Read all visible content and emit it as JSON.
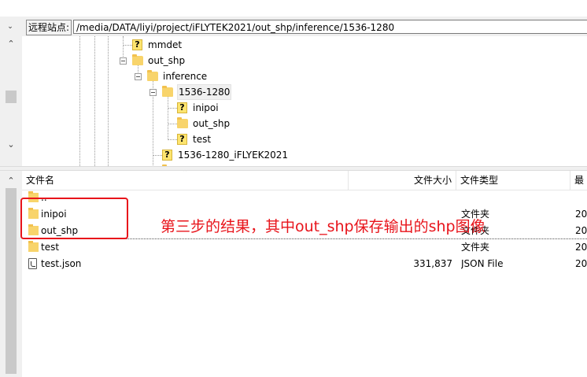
{
  "address_bar": {
    "label": "远程站点:",
    "path": "/media/DATA/liyi/project/iFLYTEK2021/out_shp/inference/1536-1280"
  },
  "tree": {
    "nodes": [
      {
        "label": "mmdet",
        "icon": "unknown-folder-icon"
      },
      {
        "label": "out_shp",
        "icon": "folder-icon",
        "expanded": true
      },
      {
        "label": "inference",
        "icon": "folder-icon",
        "expanded": true
      },
      {
        "label": "1536-1280",
        "icon": "folder-icon",
        "expanded": true,
        "selected": true
      },
      {
        "label": "inipoi",
        "icon": "unknown-folder-icon"
      },
      {
        "label": "out_shp",
        "icon": "folder-icon"
      },
      {
        "label": "test",
        "icon": "unknown-folder-icon"
      },
      {
        "label": "1536-1280_iFLYEK2021",
        "icon": "unknown-folder-icon"
      }
    ]
  },
  "file_list": {
    "columns": {
      "name": "文件名",
      "size": "文件大小",
      "type": "文件类型",
      "modified": "最"
    },
    "rows": [
      {
        "name": "..",
        "size": "",
        "type": "",
        "modified": "",
        "icon": "folder-icon"
      },
      {
        "name": "inipoi",
        "size": "",
        "type": "文件夹",
        "modified": "20",
        "icon": "folder-icon"
      },
      {
        "name": "out_shp",
        "size": "",
        "type": "文件夹",
        "modified": "20",
        "icon": "folder-icon"
      },
      {
        "name": "test",
        "size": "",
        "type": "文件夹",
        "modified": "20",
        "icon": "folder-icon"
      },
      {
        "name": "test.json",
        "size": "331,837",
        "type": "JSON File",
        "modified": "20",
        "icon": "json-file-icon"
      }
    ]
  },
  "annotation": {
    "text": "第三步的结果，其中out_shp保存输出的shp图像",
    "color": "#e8141b"
  },
  "colors": {
    "folder": "#f8d46b",
    "annotation_red": "#e8141b",
    "chrome_gray": "#f0f0f0"
  }
}
